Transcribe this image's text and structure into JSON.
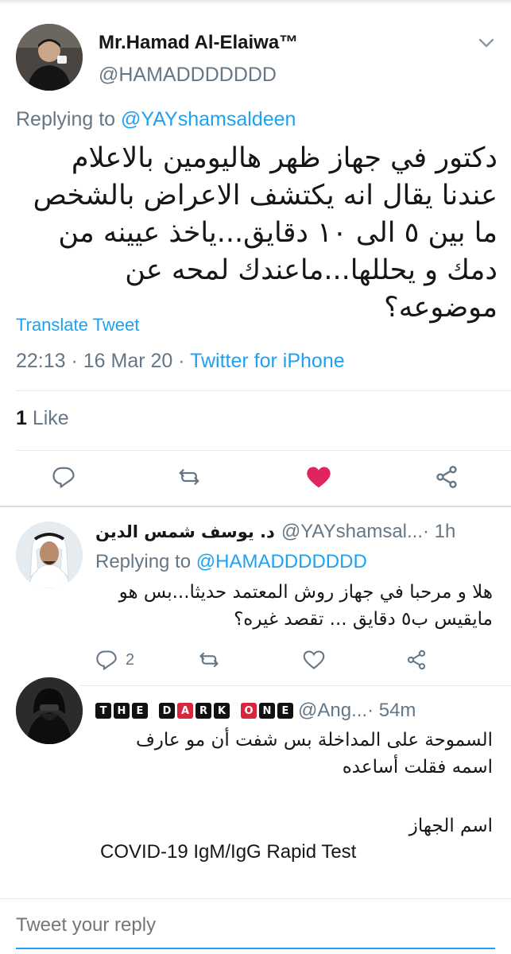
{
  "main_tweet": {
    "author_name": "Mr.Hamad Al-Elaiwa™",
    "author_handle": "@HAMADDDDDDD",
    "replying_prefix": "Replying to ",
    "replying_to": "@YAYshamsaldeen",
    "text": "دكتور في جهاز ظهر هاليومين بالاعلام عندنا يقال انه يكتشف الاعراض بالشخص ما بين ٥ الى ١٠ دقايق...ياخذ عيينه من دمك و يحللها...ماعندك لمحه عن موضوعه؟",
    "translate_label": "Translate Tweet",
    "timestamp": "22:13 · 16 Mar 20 · ",
    "source": "Twitter for iPhone",
    "likes_count": "1",
    "likes_label": " Like",
    "icons": {
      "reply": "reply-icon",
      "retweet": "retweet-icon",
      "like": "heart-icon",
      "share": "share-icon"
    },
    "like_color": "#e0245e"
  },
  "replies": [
    {
      "author_name": "د. يوسف شمس الدين",
      "author_handle": "@YAYshamsal...",
      "time": " · 1h",
      "replying_prefix": "Replying to ",
      "replying_to": "@HAMADDDDDDD",
      "text": "هلا و مرحبا في جهاز روش المعتمد حديثا...بس هو مايقيس ب٥ دقايق ... تقصد غيره؟",
      "reply_count": "2"
    },
    {
      "author_name_badge": [
        "T",
        "H",
        "E",
        "D",
        "A",
        "R",
        "K",
        "O",
        "N",
        "E"
      ],
      "author_handle": "@Ang...",
      "time": " · 54m",
      "text": "السموحة على المداخلة بس شفت أن مو عارف اسمه فقلت أساعده",
      "device_label": "اسم الجهاز",
      "device_name": "COVID-19 IgM/IgG Rapid Test"
    }
  ],
  "composer": {
    "placeholder": "Tweet your reply"
  },
  "colors": {
    "accent": "#1da1f2",
    "secondary_text": "#657786",
    "like": "#e0245e"
  }
}
